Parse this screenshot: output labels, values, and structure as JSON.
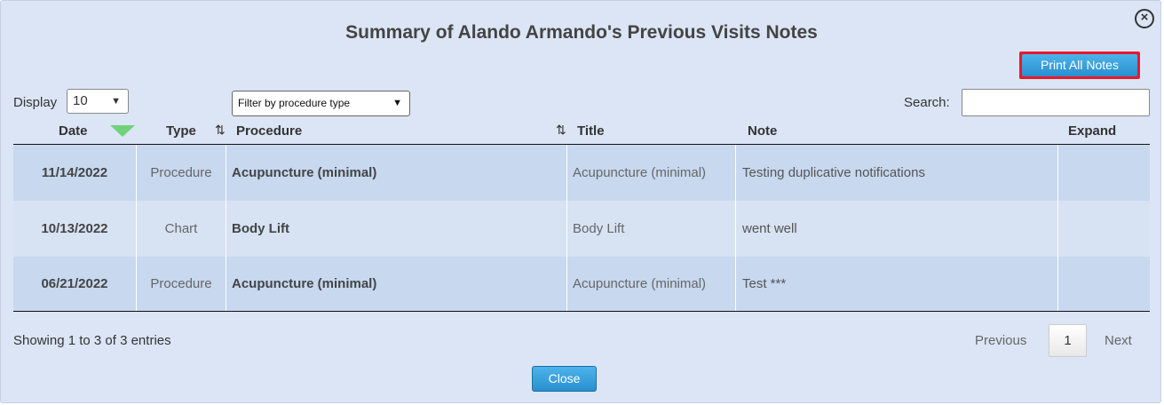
{
  "dialog": {
    "title": "Summary of Alando Armando's Previous Visits Notes",
    "close_icon": "×",
    "print_all_label": "Print All Notes",
    "close_label": "Close"
  },
  "controls": {
    "display_label": "Display",
    "display_value": "10",
    "filter_value": "Filter by procedure type",
    "search_label": "Search:",
    "search_value": ""
  },
  "table": {
    "headers": [
      "Date",
      "Type",
      "Procedure",
      "Title",
      "Note",
      "Expand"
    ],
    "sort_icon": "⇅",
    "rows": [
      {
        "date": "11/14/2022",
        "type": "Procedure",
        "procedure": "Acupuncture (minimal)",
        "title": "Acupuncture (minimal)",
        "note": "Testing duplicative notifications",
        "expand": ""
      },
      {
        "date": "10/13/2022",
        "type": "Chart",
        "procedure": "Body Lift",
        "title": "Body Lift",
        "note": "went well",
        "expand": ""
      },
      {
        "date": "06/21/2022",
        "type": "Procedure",
        "procedure": "Acupuncture (minimal)",
        "title": "Acupuncture (minimal)",
        "note": "Test ***",
        "expand": ""
      }
    ]
  },
  "pagination": {
    "info": "Showing 1 to 3 of 3 entries",
    "previous": "Previous",
    "current_page": "1",
    "next": "Next"
  },
  "colors": {
    "dialog_bg": "#dbe5f5",
    "row_odd": "#c7d8ef",
    "row_even": "#d7e2f3",
    "button_blue": "#2a8fcf",
    "highlight_red": "#e8192c",
    "sort_active": "#6fd27a"
  }
}
